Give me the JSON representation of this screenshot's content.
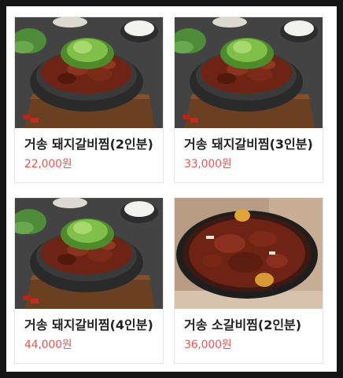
{
  "products": [
    {
      "name": "거송 돼지갈비찜(2인분)",
      "price": "22,000원",
      "image": "braised-pork-rib-dish"
    },
    {
      "name": "거송 돼지갈비찜(3인분)",
      "price": "33,000원",
      "image": "braised-pork-rib-dish"
    },
    {
      "name": "거송 돼지갈비찜(4인분)",
      "price": "44,000원",
      "image": "braised-pork-rib-dish"
    },
    {
      "name": "거송 소갈비찜(2인분)",
      "price": "36,000원",
      "image": "braised-beef-rib-dish"
    }
  ]
}
